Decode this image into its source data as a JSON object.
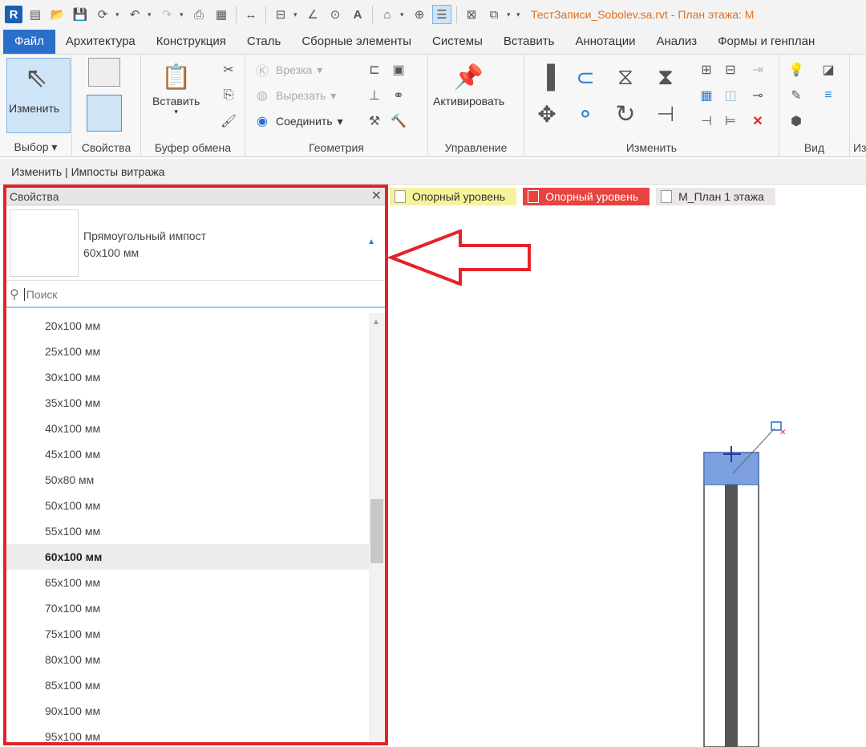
{
  "app": {
    "logo": "R",
    "title": "ТестЗаписи_Sobolev.sa.rvt - План этажа: M",
    "accent": "#2a6fc9",
    "title_color": "#e0701e"
  },
  "qat": [
    "open-icon",
    "save-icon",
    "sync-icon",
    "undo-icon",
    "redo-icon",
    "print-icon",
    "measure-icon",
    "wall-icon",
    "text-icon",
    "home-icon",
    "3d-icon",
    "switch-icon"
  ],
  "ribbon_tabs": [
    "Файл",
    "Архитектура",
    "Конструкция",
    "Сталь",
    "Сборные элементы",
    "Системы",
    "Вставить",
    "Аннотации",
    "Анализ",
    "Формы и генплан"
  ],
  "ribbon": {
    "modify": "Изменить",
    "paste": "Вставить",
    "cut_in": "Врезка",
    "cut_out": "Вырезать",
    "join": "Соединить",
    "activate": "Активировать",
    "groups": {
      "select": "Выбор",
      "properties": "Свойства",
      "clipboard": "Буфер обмена",
      "geometry": "Геометрия",
      "control": "Управление",
      "modify": "Изменить",
      "view": "Вид",
      "measure": "Из"
    }
  },
  "context_bar": "Изменить | Импосты витража",
  "view_tabs": [
    "Опорный уровень",
    "Опорный уровень",
    "M_План 1 этажа"
  ],
  "properties": {
    "title": "Свойства",
    "close": "✕",
    "family": "Прямоугольный импост",
    "type": "60x100 мм",
    "search_placeholder": "Поиск",
    "items": [
      "20x100 мм",
      "25x100 мм",
      "30x100 мм",
      "35x100 мм",
      "40x100 мм",
      "45x100 мм",
      "50x80 мм",
      "50x100 мм",
      "55x100 мм",
      "60x100 мм",
      "65x100 мм",
      "70x100 мм",
      "75x100 мм",
      "80x100 мм",
      "85x100 мм",
      "90x100 мм",
      "95x100 мм"
    ],
    "selected": "60x100 мм"
  },
  "colors": {
    "highlight_border": "#e3232a",
    "mullion_fill": "#7da0e0",
    "mullion_core": "#555555"
  }
}
